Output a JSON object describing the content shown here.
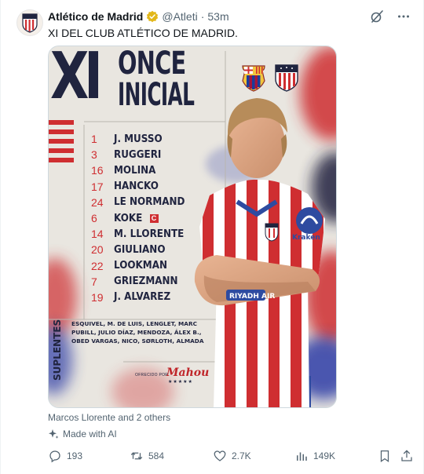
{
  "post": {
    "author": {
      "display_name": "Atlético de Madrid",
      "handle": "@Atleti",
      "separator": "·",
      "time": "53m"
    },
    "text": "XI DEL CLUB ATLÉTICO DE MADRID.",
    "icons": {
      "verified": "verified-badge-icon",
      "grok": "grok-icon",
      "more": "more-icon",
      "avatar": "atletico-crest-icon"
    }
  },
  "graphic": {
    "title_xi": "XI",
    "title_line1": "ONCE",
    "title_line2": "INICIAL",
    "lineup": [
      {
        "number": "1",
        "name": "J. MUSSO"
      },
      {
        "number": "3",
        "name": "RUGGERI"
      },
      {
        "number": "16",
        "name": "MOLINA"
      },
      {
        "number": "17",
        "name": "HANCKO"
      },
      {
        "number": "24",
        "name": "LE NORMAND"
      },
      {
        "number": "6",
        "name": "KOKE",
        "captain": "C"
      },
      {
        "number": "14",
        "name": "M. LLORENTE"
      },
      {
        "number": "20",
        "name": "GIULIANO"
      },
      {
        "number": "22",
        "name": "LOOKMAN"
      },
      {
        "number": "7",
        "name": "GRIEZMANN"
      },
      {
        "number": "19",
        "name": "J. ALVAREZ"
      }
    ],
    "subs_label": "SUPLENTES",
    "subs": "ESQUIVEL, M. DE LUIS, LENGLET, MARC PUBILL, JULIO DÍAZ, MENDOZA, ÁLEX B., OBED VARGAS, NICO, SØRLOTH, ALMADA",
    "sponsor_pre": "OFRECIDO POR",
    "sponsor": "Mahou",
    "sponsor_stars": "★★★★★",
    "jersey_sponsor": "Kraken",
    "sleeve_text": "RIYADH AIR",
    "crests": [
      "fc-barcelona-crest",
      "atletico-madrid-crest"
    ],
    "colors": {
      "navy": "#20243f",
      "red": "#cf2e31",
      "paper": "#e9e6e0"
    }
  },
  "meta": {
    "caption": "Marcos Llorente and 2 others",
    "made_with_ai": "Made with AI"
  },
  "actions": {
    "replies": "193",
    "reposts": "584",
    "likes": "2.7K",
    "views": "149K"
  }
}
